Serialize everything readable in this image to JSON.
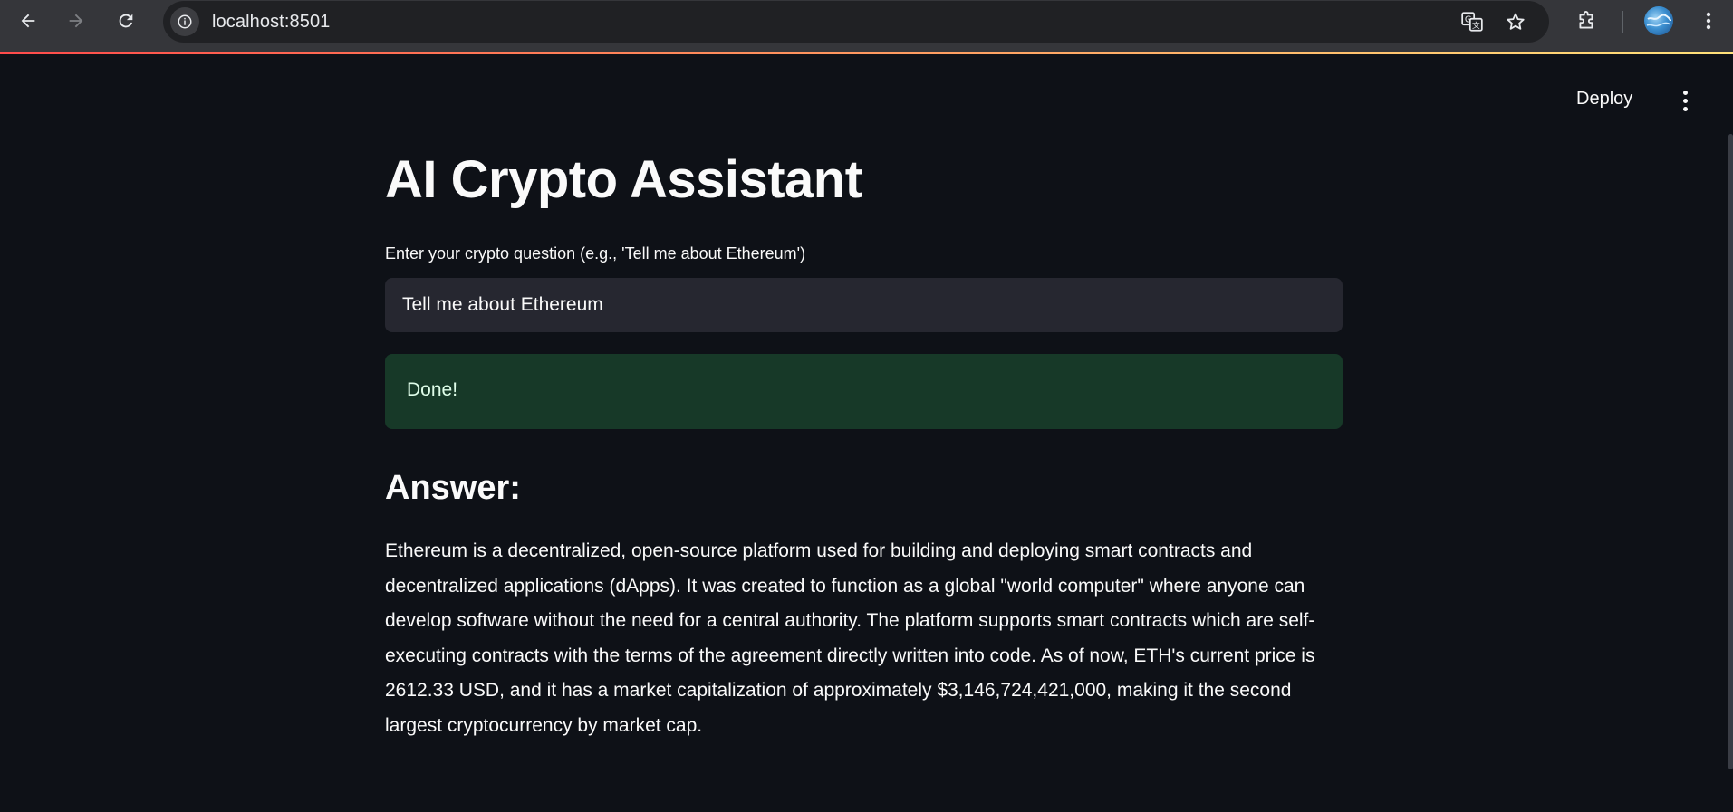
{
  "browser": {
    "url": "localhost:8501",
    "icons": {
      "back": "arrow-left-icon",
      "forward": "arrow-right-icon",
      "reload": "reload-icon",
      "site_info": "info-icon",
      "translate": "translate-icon",
      "bookmark": "star-icon",
      "extensions": "puzzle-icon",
      "profile": "avatar",
      "menu": "kebab-menu-icon"
    },
    "accent_gradient": [
      "#ff4b4b",
      "#ff8a5b",
      "#ffe27a"
    ]
  },
  "app_header": {
    "deploy_label": "Deploy"
  },
  "main": {
    "title": "AI Crypto Assistant",
    "input_label": "Enter your crypto question (e.g., 'Tell me about Ethereum')",
    "input_value": "Tell me about Ethereum",
    "status_message": "Done!",
    "answer_heading": "Answer:",
    "answer_text": "Ethereum is a decentralized, open-source platform used for building and deploying smart contracts and decentralized applications (dApps). It was created to function as a global \"world computer\" where anyone can develop software without the need for a central authority. The platform supports smart contracts which are self-executing contracts with the terms of the agreement directly written into code. As of now, ETH's current price is 2612.33 USD, and it has a market capitalization of approximately $3,146,724,421,000, making it the second largest cryptocurrency by market cap."
  },
  "colors": {
    "background": "#0e1117",
    "input_background": "#262730",
    "success_background": "#173928",
    "text": "#fafafa"
  }
}
